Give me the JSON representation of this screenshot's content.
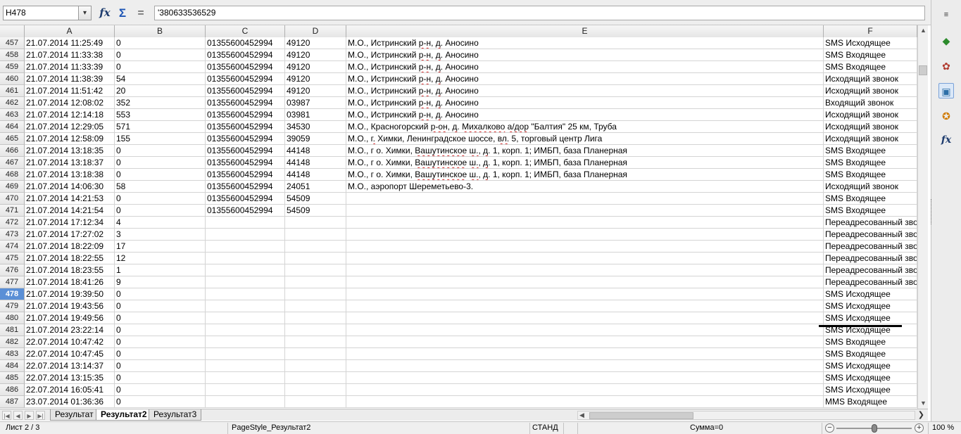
{
  "formula_bar": {
    "name_box": "H478",
    "content": "'380633536529",
    "function_wizard_glyph": "fx",
    "sum_glyph": "Σ",
    "equals_glyph": "="
  },
  "columns": [
    "A",
    "B",
    "C",
    "D",
    "E",
    "F"
  ],
  "rows": [
    {
      "num": "457",
      "a": "21.07.2014 11:25:49",
      "b": "0",
      "c": "01355600452994",
      "d": "49120",
      "e": "М.О., Истринский р-н, д. Аносино",
      "f": "SMS Исходящее"
    },
    {
      "num": "458",
      "a": "21.07.2014 11:33:38",
      "b": "0",
      "c": "01355600452994",
      "d": "49120",
      "e": "М.О., Истринский р-н, д. Аносино",
      "f": "SMS Входящее"
    },
    {
      "num": "459",
      "a": "21.07.2014 11:33:39",
      "b": "0",
      "c": "01355600452994",
      "d": "49120",
      "e": "М.О., Истринский р-н, д. Аносино",
      "f": "SMS Входящее"
    },
    {
      "num": "460",
      "a": "21.07.2014 11:38:39",
      "b": "54",
      "c": "01355600452994",
      "d": "49120",
      "e": "М.О., Истринский р-н, д. Аносино",
      "f": "Исходящий звонок"
    },
    {
      "num": "461",
      "a": "21.07.2014 11:51:42",
      "b": "20",
      "c": "01355600452994",
      "d": "49120",
      "e": "М.О., Истринский р-н, д. Аносино",
      "f": "Исходящий звонок"
    },
    {
      "num": "462",
      "a": "21.07.2014 12:08:02",
      "b": "352",
      "c": "01355600452994",
      "d": "03987",
      "e": "М.О., Истринский р-н, д. Аносино",
      "f": "Входящий звонок"
    },
    {
      "num": "463",
      "a": "21.07.2014 12:14:18",
      "b": "553",
      "c": "01355600452994",
      "d": "03981",
      "e": "М.О., Истринский р-н, д. Аносино",
      "f": "Исходящий звонок"
    },
    {
      "num": "464",
      "a": "21.07.2014 12:29:05",
      "b": "571",
      "c": "01355600452994",
      "d": "34530",
      "e": "М.О., Красногорский р-он, д. Михалково а/дор \"Балтия\" 25 км, Труба",
      "f": "Исходящий звонок"
    },
    {
      "num": "465",
      "a": "21.07.2014 12:58:09",
      "b": "155",
      "c": "01355600452994",
      "d": "39059",
      "e": "М.О., г. Химки, Ленинградское шоссе, вл. 5, торговый центр Лига",
      "f": "Исходящий звонок"
    },
    {
      "num": "466",
      "a": "21.07.2014 13:18:35",
      "b": "0",
      "c": "01355600452994",
      "d": "44148",
      "e": "М.О., г о. Химки, Вашутинское ш., д. 1, корп. 1; ИМБП, база Планерная",
      "f": "SMS Входящее"
    },
    {
      "num": "467",
      "a": "21.07.2014 13:18:37",
      "b": "0",
      "c": "01355600452994",
      "d": "44148",
      "e": "М.О., г о. Химки, Вашутинское ш., д. 1, корп. 1; ИМБП, база Планерная",
      "f": "SMS Входящее"
    },
    {
      "num": "468",
      "a": "21.07.2014 13:18:38",
      "b": "0",
      "c": "01355600452994",
      "d": "44148",
      "e": "М.О., г о. Химки, Вашутинское ш., д. 1, корп. 1; ИМБП, база Планерная",
      "f": "SMS Входящее"
    },
    {
      "num": "469",
      "a": "21.07.2014 14:06:30",
      "b": "58",
      "c": "01355600452994",
      "d": "24051",
      "e": "М.О., аэропорт Шереметьево-3.",
      "f": "Исходящий звонок"
    },
    {
      "num": "470",
      "a": "21.07.2014 14:21:53",
      "b": "0",
      "c": "01355600452994",
      "d": "54509",
      "e": "",
      "f": "SMS Входящее"
    },
    {
      "num": "471",
      "a": "21.07.2014 14:21:54",
      "b": "0",
      "c": "01355600452994",
      "d": "54509",
      "e": "",
      "f": "SMS Входящее"
    },
    {
      "num": "472",
      "a": "21.07.2014 17:12:34",
      "b": "4",
      "c": "",
      "d": "",
      "e": "",
      "f": "Переадресованный звонок"
    },
    {
      "num": "473",
      "a": "21.07.2014 17:27:02",
      "b": "3",
      "c": "",
      "d": "",
      "e": "",
      "f": "Переадресованный звонок"
    },
    {
      "num": "474",
      "a": "21.07.2014 18:22:09",
      "b": "17",
      "c": "",
      "d": "",
      "e": "",
      "f": "Переадресованный звонок"
    },
    {
      "num": "475",
      "a": "21.07.2014 18:22:55",
      "b": "12",
      "c": "",
      "d": "",
      "e": "",
      "f": "Переадресованный звонок"
    },
    {
      "num": "476",
      "a": "21.07.2014 18:23:55",
      "b": "1",
      "c": "",
      "d": "",
      "e": "",
      "f": "Переадресованный звонок"
    },
    {
      "num": "477",
      "a": "21.07.2014 18:41:26",
      "b": "9",
      "c": "",
      "d": "",
      "e": "",
      "f": "Переадресованный звонок"
    },
    {
      "num": "478",
      "a": "21.07.2014 19:39:50",
      "b": "0",
      "c": "",
      "d": "",
      "e": "",
      "f": "SMS Исходящее",
      "active": true
    },
    {
      "num": "479",
      "a": "21.07.2014 19:43:56",
      "b": "0",
      "c": "",
      "d": "",
      "e": "",
      "f": "SMS Исходящее"
    },
    {
      "num": "480",
      "a": "21.07.2014 19:49:56",
      "b": "0",
      "c": "",
      "d": "",
      "e": "",
      "f": "SMS Исходящее"
    },
    {
      "num": "481",
      "a": "21.07.2014 23:22:14",
      "b": "0",
      "c": "",
      "d": "",
      "e": "",
      "f": "SMS Исходящее"
    },
    {
      "num": "482",
      "a": "22.07.2014 10:47:42",
      "b": "0",
      "c": "",
      "d": "",
      "e": "",
      "f": "SMS Входящее"
    },
    {
      "num": "483",
      "a": "22.07.2014 10:47:45",
      "b": "0",
      "c": "",
      "d": "",
      "e": "",
      "f": "SMS Входящее"
    },
    {
      "num": "484",
      "a": "22.07.2014 13:14:37",
      "b": "0",
      "c": "",
      "d": "",
      "e": "",
      "f": "SMS Исходящее"
    },
    {
      "num": "485",
      "a": "22.07.2014 13:15:35",
      "b": "0",
      "c": "",
      "d": "",
      "e": "",
      "f": "SMS Исходящее"
    },
    {
      "num": "486",
      "a": "22.07.2014 16:05:41",
      "b": "0",
      "c": "",
      "d": "",
      "e": "",
      "f": "SMS Исходящее"
    },
    {
      "num": "487",
      "a": "23.07.2014 01:36:36",
      "b": "0",
      "c": "",
      "d": "",
      "e": "",
      "f": "MMS Входящее"
    }
  ],
  "sheet_tabs": [
    {
      "label": "Результат",
      "active": false
    },
    {
      "label": "Результат2",
      "active": true
    },
    {
      "label": "Результат3",
      "active": false
    }
  ],
  "status_bar": {
    "sheet": "Лист 2 / 3",
    "page_style": "PageStyle_Результат2",
    "mode": "СТАНД",
    "sum": "Сумма=0",
    "zoom": "100 %",
    "zoom_level": 0.5
  },
  "sidebar": {
    "menu_glyph": "≡",
    "properties_glyph": "◆",
    "styles_glyph": "✿",
    "gallery_glyph": "▣",
    "navigator_glyph": "✪",
    "functions_glyph": "fx"
  },
  "icons": {
    "tab_first": "|◀",
    "tab_prev": "◀",
    "tab_next": "▶",
    "tab_last": "▶|",
    "scroll_up": "▲",
    "scroll_down": "▼",
    "scroll_left": "◀",
    "scroll_right": "❯",
    "dropdown": "▾"
  }
}
